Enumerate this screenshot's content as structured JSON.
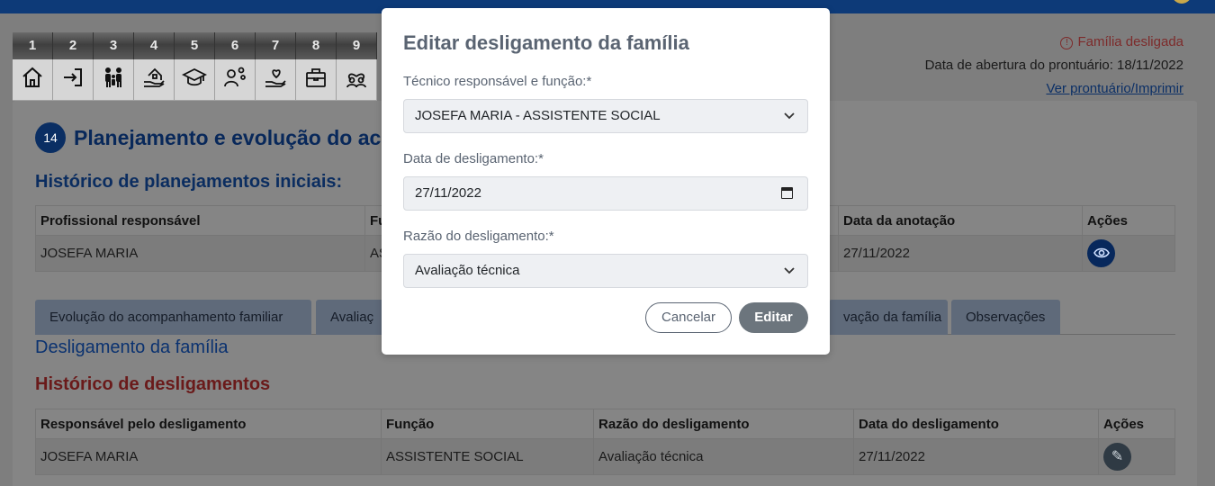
{
  "steps": [
    {
      "num": "1",
      "icon": "home-icon"
    },
    {
      "num": "2",
      "icon": "login-icon"
    },
    {
      "num": "3",
      "icon": "family-icon"
    },
    {
      "num": "4",
      "icon": "house-hand-icon"
    },
    {
      "num": "5",
      "icon": "graduation-cap-icon"
    },
    {
      "num": "6",
      "icon": "person-gears-icon"
    },
    {
      "num": "7",
      "icon": "heart-hand-icon"
    },
    {
      "num": "8",
      "icon": "briefcase-icon"
    },
    {
      "num": "9",
      "icon": "group-heart-icon"
    }
  ],
  "status": {
    "desligada": "Família desligada",
    "abertura": "Data de abertura do prontuário: 18/11/2022",
    "link": "Ver prontuário/Imprimir"
  },
  "section": {
    "number": "14",
    "title": "Planejamento e evolução do ac"
  },
  "historico_planejamentos": {
    "title": "Histórico de planejamentos iniciais:",
    "headers": [
      "Profissional responsável",
      "Fu",
      "Data da anotação",
      "Ações"
    ],
    "row": [
      "JOSEFA MARIA",
      "AS",
      "27/11/2022"
    ]
  },
  "tabs": [
    "Evolução do acompanhamento familiar",
    "Avaliaç",
    "vação da família",
    "Observações"
  ],
  "desligamento": {
    "title": "Desligamento da família",
    "historico_title": "Histórico de desligamentos",
    "headers": [
      "Responsável pelo desligamento",
      "Função",
      "Razão do desligamento",
      "Data do desligamento",
      "Ações"
    ],
    "row": [
      "JOSEFA MARIA",
      "ASSISTENTE SOCIAL",
      "Avaliação técnica",
      "27/11/2022"
    ]
  },
  "modal": {
    "title": "Editar desligamento da família",
    "tecnico_label": "Técnico responsável e função:*",
    "tecnico_value": "JOSEFA MARIA - ASSISTENTE SOCIAL",
    "data_label": "Data de desligamento:*",
    "data_value": "27/11/2022",
    "razao_label": "Razão do desligamento:*",
    "razao_value": "Avaliação técnica",
    "cancel": "Cancelar",
    "edit": "Editar"
  }
}
